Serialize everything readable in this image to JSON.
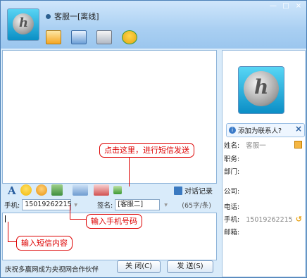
{
  "window": {
    "title": "客服一[离线]",
    "controls": [
      "—",
      "□",
      "×"
    ]
  },
  "header_icons": [
    "send-file-icon",
    "contacts-icon",
    "print-icon",
    "group-icon"
  ],
  "toolbar": {
    "history": "对话记录"
  },
  "sms": {
    "phone_label": "手机:",
    "phone_value": "15019262215",
    "sign_label": "签名:",
    "sign_value": "[客服二]",
    "counter": "(65字/条)"
  },
  "bottom": {
    "ad": "庆祝多赢网成为央视网合作伙伴",
    "close_label": "关 闭(C)",
    "send_label": "发 送(S)"
  },
  "contact_panel": {
    "add_prompt": "添加为联系人?",
    "fields": [
      {
        "label": "姓名:",
        "value": "客服一"
      },
      {
        "label": "职务:",
        "value": ""
      },
      {
        "label": "部门:",
        "value": ""
      },
      {
        "label": "公司:",
        "value": ""
      },
      {
        "label": "电话:",
        "value": ""
      },
      {
        "label": "手机:",
        "value": "15019262215"
      },
      {
        "label": "邮箱:",
        "value": ""
      }
    ]
  },
  "annotations": {
    "click_here": "点击这里，进行短信发送",
    "enter_phone": "输入手机号码",
    "enter_sms": "输入短信内容"
  }
}
